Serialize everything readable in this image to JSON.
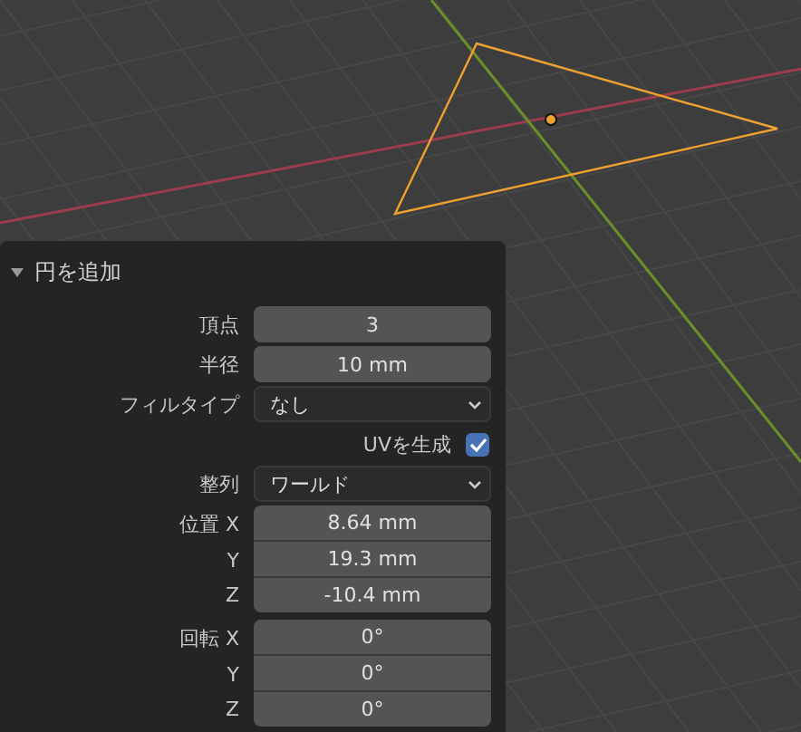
{
  "panel": {
    "title": "円を追加",
    "expanded": true,
    "fields": [
      {
        "kind": "number",
        "label": "頂点",
        "value": "3"
      },
      {
        "kind": "number",
        "label": "半径",
        "value": "10 mm"
      },
      {
        "kind": "dropdown",
        "label": "フィルタイプ",
        "value": "なし"
      },
      {
        "kind": "checkbox",
        "label": "UVを生成",
        "checked": true
      },
      {
        "kind": "dropdown",
        "label": "整列",
        "value": "ワールド"
      },
      {
        "kind": "vector",
        "label": "位置",
        "rows": [
          {
            "axis": "X",
            "value": "8.64 mm"
          },
          {
            "axis": "Y",
            "value": "19.3 mm"
          },
          {
            "axis": "Z",
            "value": "-10.4 mm"
          }
        ]
      },
      {
        "kind": "vector",
        "label": "回転",
        "rows": [
          {
            "axis": "X",
            "value": "0°"
          },
          {
            "axis": "Y",
            "value": "0°"
          },
          {
            "axis": "Z",
            "value": "0°"
          }
        ]
      }
    ]
  }
}
